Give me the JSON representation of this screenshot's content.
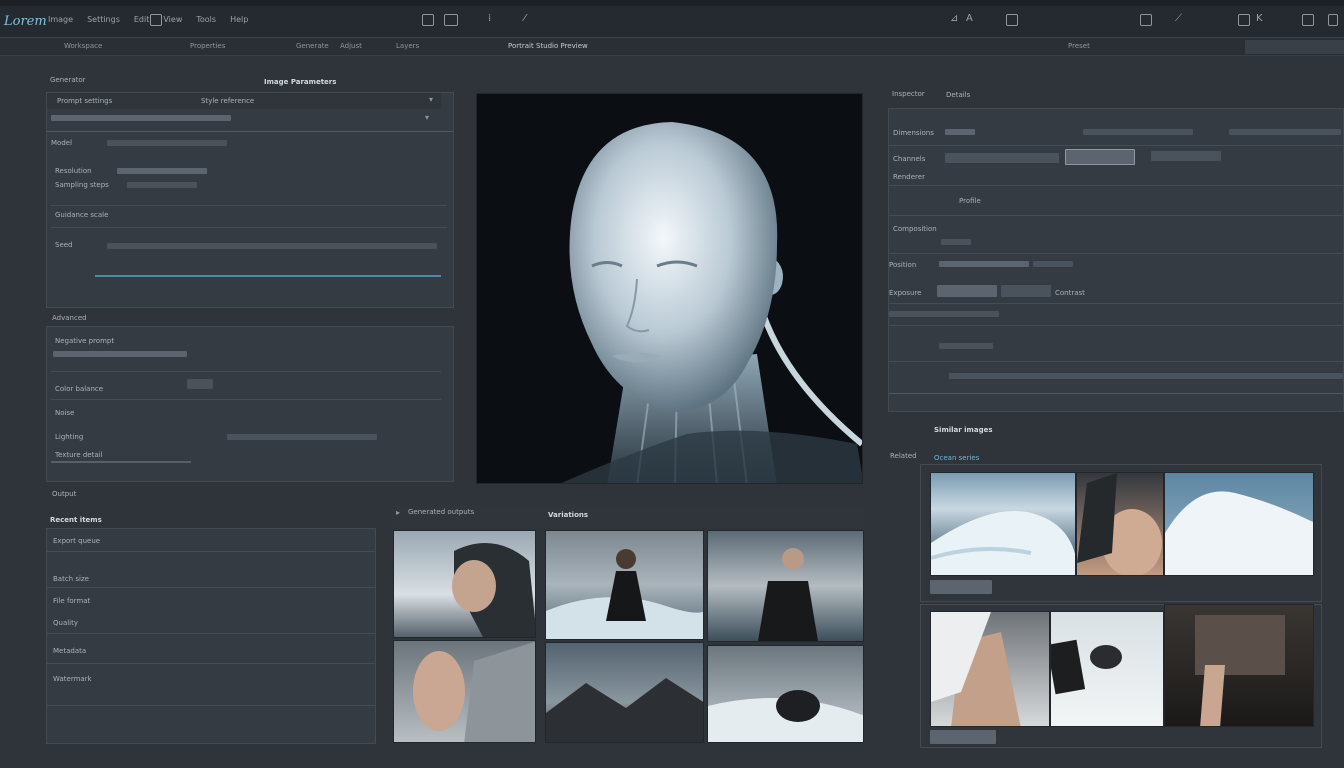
{
  "app": {
    "logo": "Lorem"
  },
  "menu": [
    "Image",
    "Settings",
    "Edit",
    "View",
    "Tools",
    "Help"
  ],
  "toolbar": {
    "right_labels": [
      "A",
      "K"
    ]
  },
  "subbar": {
    "items": [
      "Workspace",
      "Properties",
      "Generate",
      "Adjust",
      "Layers",
      "Preset"
    ],
    "center_label": "Portrait Studio Preview"
  },
  "left_panel": {
    "header": "Generator",
    "title": "Image Parameters",
    "section1_rows": [
      "Prompt settings",
      "Style reference",
      "Model",
      "Resolution",
      "Sampling steps",
      "Guidance scale",
      "Seed"
    ],
    "section2_header": "Advanced",
    "section2_rows": [
      "Negative prompt",
      "Color balance",
      "Noise",
      "Lighting",
      "Texture detail"
    ],
    "footer_label": "Output"
  },
  "bottom_left": {
    "title": "Recent items",
    "rows": [
      "Export queue",
      "Batch size",
      "File format",
      "Quality",
      "Metadata",
      "Watermark"
    ]
  },
  "gallery": {
    "header": "Variations",
    "subheader": "Generated outputs"
  },
  "right_panel": {
    "header": "Inspector",
    "subheader": "Details",
    "rows": [
      "Dimensions",
      "Channels",
      "Renderer",
      "Profile",
      "Composition",
      "Position",
      "Exposure",
      "Contrast"
    ]
  },
  "right_gallery": {
    "title": "Similar images",
    "label": "Related",
    "sublabel": "Ocean series"
  },
  "colors": {
    "accent": "#6fb6d6",
    "background": "#2f343b",
    "panel": "#353b42",
    "viewer_bg": "#0b0e13"
  }
}
